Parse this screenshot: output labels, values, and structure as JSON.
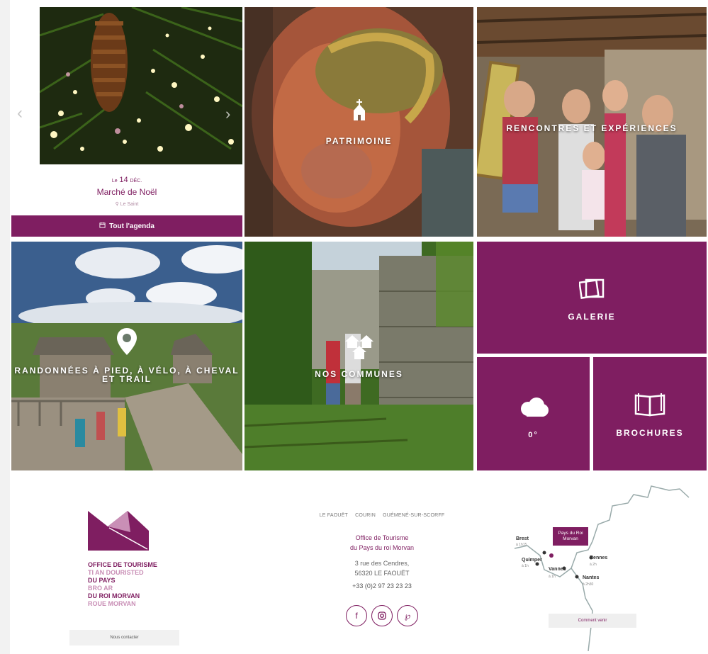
{
  "agenda": {
    "date_prefix": "Le",
    "date_day": "14",
    "date_month": "DÉC.",
    "title": "Marché de Noël",
    "place": "Le Saint",
    "button_label": "Tout l'agenda",
    "prev_arrow": "‹",
    "next_arrow": "›"
  },
  "tiles": {
    "patrimoine": "PATRIMOINE",
    "rencontres": "RENCONTRES ET EXPÉRIENCES",
    "randonnees": "RANDONNÉES À PIED, À VÉLO, À CHEVAL ET TRAIL",
    "communes": "NOS COMMUNES",
    "galerie": "GALERIE",
    "meteo": "0°",
    "brochures": "BROCHURES"
  },
  "footer": {
    "logo_lines": [
      {
        "text": "OFFICE DE TOURISME",
        "style": "a"
      },
      {
        "text": "TI AN DOURISTED",
        "style": "b"
      },
      {
        "text": "DU PAYS",
        "style": "a"
      },
      {
        "text": "BRO AR",
        "style": "b"
      },
      {
        "text": "DU ROI MORVAN",
        "style": "a"
      },
      {
        "text": "ROUE MORVAN",
        "style": "b"
      }
    ],
    "contact_label": "Nous contacter",
    "links": [
      "LE FAOUËT",
      "COURIN",
      "GUÉMENÉ-SUR-SCORFF"
    ],
    "org_line1": "Office de Tourisme",
    "org_line2": "du Pays du roi Morvan",
    "addr_line1": "3 rue des Cendres,",
    "addr_line2": "56320 LE FAOUËT",
    "phone": "+33 (0)2 97 23 23 23",
    "socials": [
      "facebook-icon",
      "instagram-icon",
      "pinterest-icon"
    ]
  },
  "map": {
    "tag": "Pays du Roi Morvan",
    "cities": [
      {
        "name": "Brest",
        "time": "à 1h15"
      },
      {
        "name": "Quimper",
        "time": "à 1h"
      },
      {
        "name": "Vannes",
        "time": "à 1h"
      },
      {
        "name": "Rennes",
        "time": "à 2h"
      },
      {
        "name": "Nantes",
        "time": "à 2h30"
      }
    ],
    "button": "Comment venir"
  },
  "colors": {
    "brand": "#7f1e61",
    "brand_light": "#c98fb6"
  }
}
